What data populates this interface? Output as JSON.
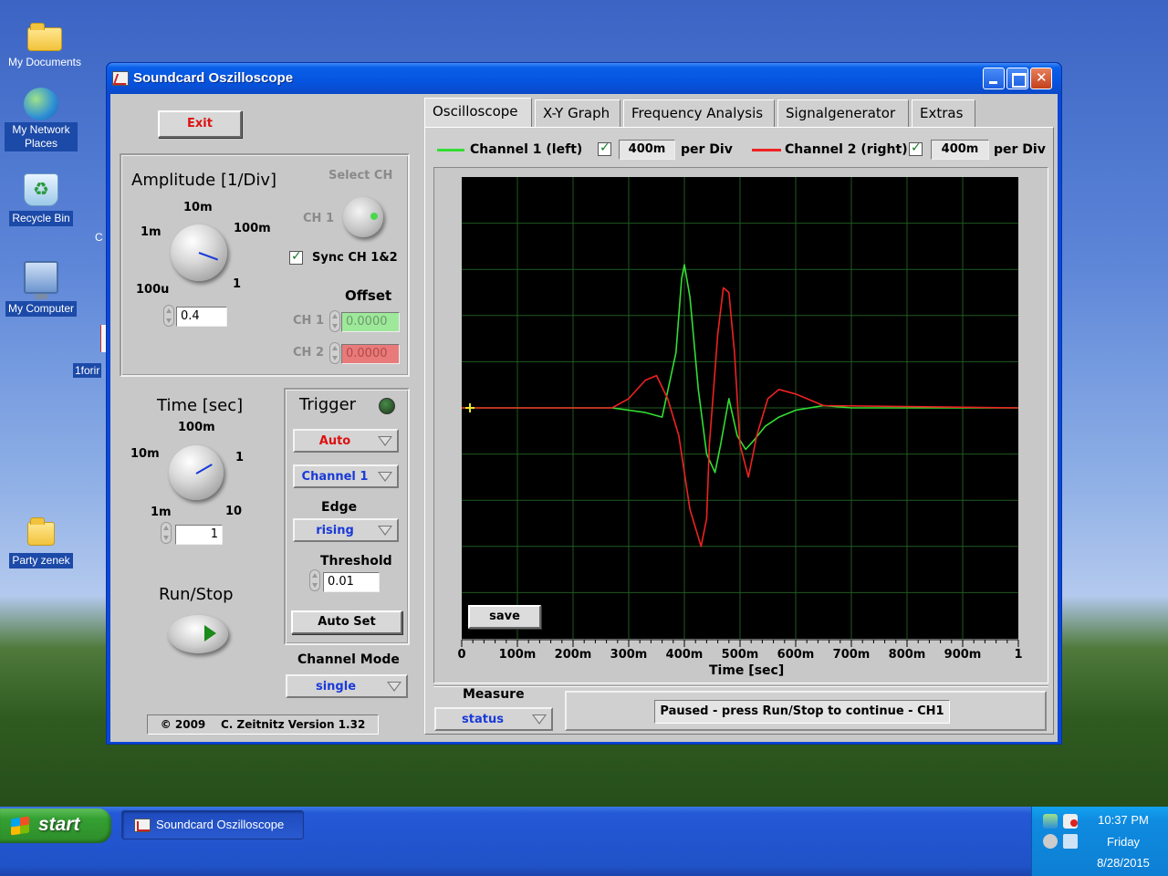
{
  "desktop": {
    "icons": [
      {
        "label": "My Documents"
      },
      {
        "label": "My Network Places"
      },
      {
        "label": "Recycle Bin"
      },
      {
        "label": "My Computer"
      },
      {
        "label": "Party zenek"
      }
    ],
    "partial_labels": [
      "C",
      "1forir"
    ]
  },
  "window": {
    "title": "Soundcard Oszilloscope"
  },
  "left_panel": {
    "exit_label": "Exit",
    "amplitude": {
      "title": "Amplitude [1/Div]",
      "scale_labels": [
        "10m",
        "1m",
        "100m",
        "100u",
        "1"
      ],
      "value": "0.4",
      "select_ch_label": "Select CH",
      "ch1_label": "CH 1",
      "sync_label": "Sync CH 1&2",
      "sync_checked": true,
      "offset_label": "Offset",
      "offset_ch1_label": "CH 1",
      "offset_ch1_value": "0.0000",
      "offset_ch2_label": "CH 2",
      "offset_ch2_value": "0.0000"
    },
    "time": {
      "title": "Time [sec]",
      "scale_labels": [
        "100m",
        "10m",
        "1",
        "1m",
        "10"
      ],
      "value": "1"
    },
    "trigger": {
      "title": "Trigger",
      "mode": "Auto",
      "channel": "Channel 1",
      "edge_label": "Edge",
      "edge": "rising",
      "threshold_label": "Threshold",
      "threshold": "0.01",
      "autoset_label": "Auto Set"
    },
    "runstop_label": "Run/Stop",
    "channel_mode_label": "Channel Mode",
    "channel_mode": "single",
    "copyright": "© 2009    C. Zeitnitz Version 1.32"
  },
  "tabs": [
    {
      "label": "Oscilloscope",
      "active": true
    },
    {
      "label": "X-Y Graph",
      "active": false
    },
    {
      "label": "Frequency Analysis",
      "active": false
    },
    {
      "label": "Signalgenerator",
      "active": false
    },
    {
      "label": "Extras",
      "active": false
    }
  ],
  "channels": {
    "ch1_label": "Channel 1 (left)",
    "ch1_value": "400m",
    "ch1_color": "#33dd33",
    "ch2_label": "Channel 2 (right)",
    "ch2_value": "400m",
    "ch2_color": "#ee2222",
    "per_div_label": "per Div"
  },
  "scope": {
    "save_label": "save",
    "xlabel": "Time [sec]",
    "xticks": [
      "0",
      "100m",
      "200m",
      "300m",
      "400m",
      "500m",
      "600m",
      "700m",
      "800m",
      "900m",
      "1"
    ]
  },
  "chart_data": {
    "type": "line",
    "xlabel": "Time [sec]",
    "xlim": [
      0,
      1
    ],
    "ylim": [
      -5,
      5
    ],
    "grid": true,
    "series": [
      {
        "name": "Channel 1 (left)",
        "color": "#33dd33",
        "x": [
          0,
          0.27,
          0.33,
          0.36,
          0.385,
          0.395,
          0.4,
          0.41,
          0.425,
          0.44,
          0.455,
          0.465,
          0.48,
          0.495,
          0.51,
          0.525,
          0.545,
          0.57,
          0.6,
          0.65,
          0.7,
          1
        ],
        "y": [
          0,
          0,
          -0.1,
          -0.2,
          1.2,
          2.8,
          3.1,
          2.4,
          0.4,
          -1.0,
          -1.4,
          -0.8,
          0.2,
          -0.6,
          -0.9,
          -0.7,
          -0.4,
          -0.2,
          -0.05,
          0.05,
          0,
          0
        ]
      },
      {
        "name": "Channel 2 (right)",
        "color": "#ee2222",
        "x": [
          0,
          0.27,
          0.3,
          0.33,
          0.35,
          0.37,
          0.39,
          0.41,
          0.43,
          0.44,
          0.445,
          0.46,
          0.47,
          0.48,
          0.49,
          0.5,
          0.515,
          0.53,
          0.55,
          0.57,
          0.6,
          0.65,
          1
        ],
        "y": [
          0,
          0,
          0.2,
          0.6,
          0.7,
          0.2,
          -0.6,
          -2.2,
          -3.0,
          -2.4,
          -0.8,
          1.6,
          2.6,
          2.5,
          1.2,
          -0.8,
          -1.5,
          -0.6,
          0.2,
          0.4,
          0.3,
          0.05,
          0
        ]
      }
    ]
  },
  "measure": {
    "label": "Measure",
    "value": "status",
    "status_text": "Paused - press Run/Stop to continue - CH1"
  },
  "taskbar": {
    "start_label": "start",
    "task_label": "Soundcard Oszilloscope",
    "time": "10:37 PM",
    "day": "Friday",
    "date": "8/28/2015"
  }
}
